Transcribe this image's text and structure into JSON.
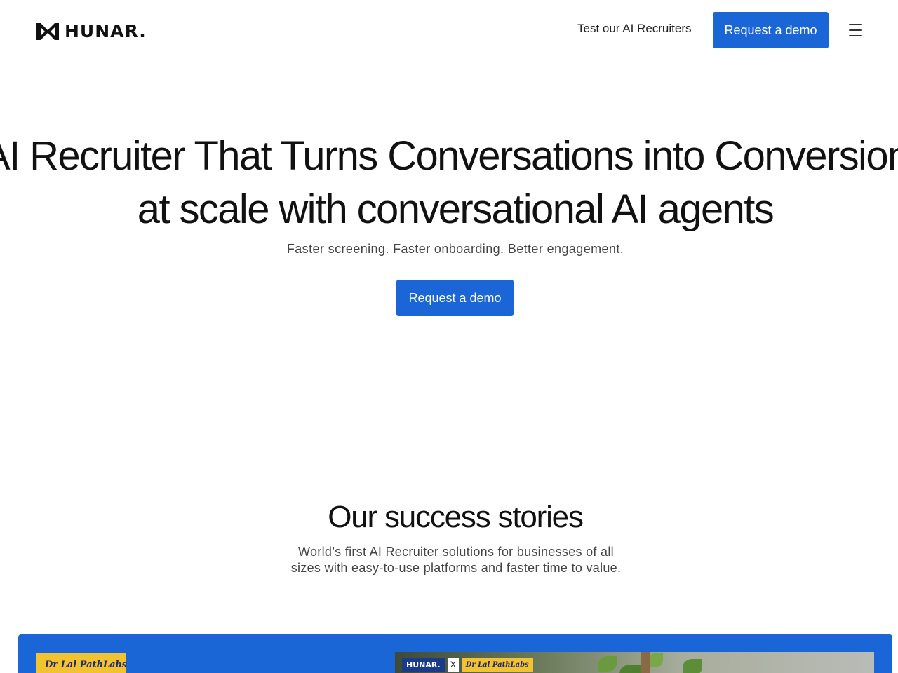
{
  "header": {
    "logo_text": "HUNAR.",
    "nav_link": "Test our AI Recruiters",
    "cta_label": "Request a demo",
    "menu_icon": "hamburger-menu-icon"
  },
  "hero": {
    "title_line1": "AI Recruiter That Turns Conversations into Conversions",
    "title_line2": "at scale with conversational AI agents",
    "subtitle": "Faster screening. Faster onboarding. Better engagement.",
    "cta_label": "Request a demo"
  },
  "stories": {
    "title": "Our success stories",
    "subtitle": "World’s first AI Recruiter solutions for businesses of all sizes with easy-to-use platforms and faster time to value.",
    "card": {
      "partner_logo_text": "Dr Lal PathLabs",
      "video_banner": {
        "brand": "HUNAR.",
        "separator": "X",
        "partner": "Dr Lal PathLabs"
      }
    }
  },
  "colors": {
    "accent": "#1a66d6",
    "text": "#111111",
    "muted": "#444444"
  }
}
